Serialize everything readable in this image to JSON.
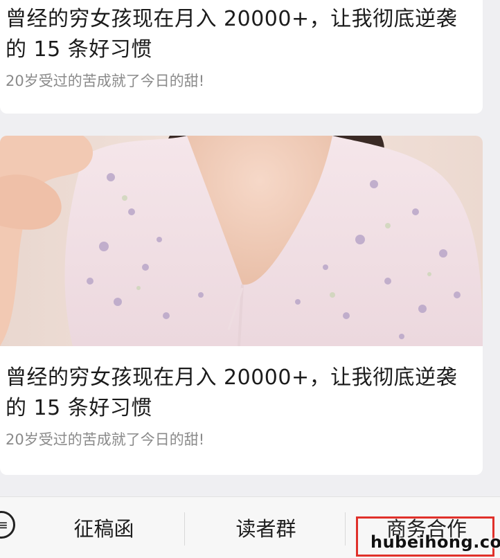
{
  "articles": [
    {
      "title": "曾经的穷女孩现在月入 20000+，让我彻底逆袭的 15 条好习惯",
      "subtitle": "20岁受过的苦成就了今日的甜!"
    },
    {
      "image_alt": "woman in floral dress",
      "title": "曾经的穷女孩现在月入 20000+，让我彻底逆袭的 15 条好习惯",
      "subtitle": "20岁受过的苦成就了今日的甜!"
    }
  ],
  "menu": {
    "icon": "menu-toggle-icon",
    "items": [
      {
        "label": "征稿函"
      },
      {
        "label": "读者群"
      },
      {
        "label": "商务合作"
      }
    ]
  },
  "colors": {
    "highlight": "#e0302a",
    "background": "#efeff2"
  },
  "watermark": "hubeihong.com"
}
